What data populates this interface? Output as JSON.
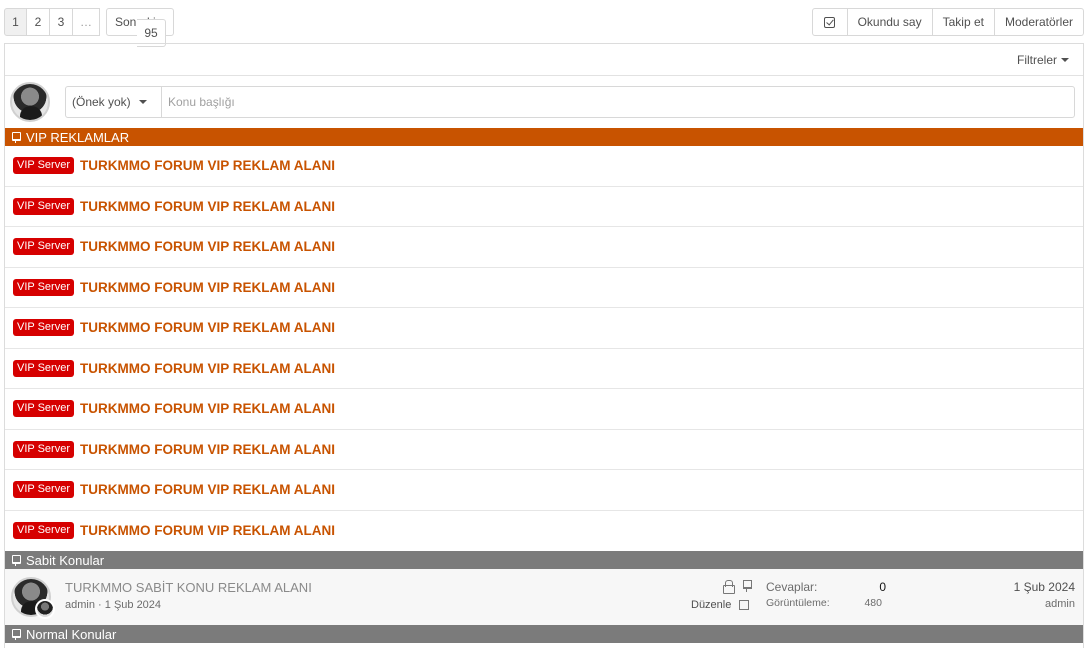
{
  "pagination": {
    "pages": [
      "1",
      "2",
      "3",
      "…",
      "95"
    ],
    "active": "1",
    "next_label": "Sonraki"
  },
  "actions": {
    "mark_read_label": "Okundu say",
    "follow_label": "Takip et",
    "moderators_label": "Moderatörler"
  },
  "filters": {
    "label": "Filtreler"
  },
  "quick_thread": {
    "prefix": "(Önek yok)",
    "placeholder": "Konu başlığı"
  },
  "sections": {
    "vip_title": "VIP REKLAMLAR",
    "sticky_title": "Sabit Konular",
    "normal_title": "Normal Konular"
  },
  "vip_threads": [
    {
      "badge": "VIP Server",
      "title": "TURKMMO FORUM VIP REKLAM ALANI"
    },
    {
      "badge": "VIP Server",
      "title": "TURKMMO FORUM VIP REKLAM ALANI"
    },
    {
      "badge": "VIP Server",
      "title": "TURKMMO FORUM VIP REKLAM ALANI"
    },
    {
      "badge": "VIP Server",
      "title": "TURKMMO FORUM VIP REKLAM ALANI"
    },
    {
      "badge": "VIP Server",
      "title": "TURKMMO FORUM VIP REKLAM ALANI"
    },
    {
      "badge": "VIP Server",
      "title": "TURKMMO FORUM VIP REKLAM ALANI"
    },
    {
      "badge": "VIP Server",
      "title": "TURKMMO FORUM VIP REKLAM ALANI"
    },
    {
      "badge": "VIP Server",
      "title": "TURKMMO FORUM VIP REKLAM ALANI"
    },
    {
      "badge": "VIP Server",
      "title": "TURKMMO FORUM VIP REKLAM ALANI"
    },
    {
      "badge": "VIP Server",
      "title": "TURKMMO FORUM VIP REKLAM ALANI"
    }
  ],
  "sticky_thread": {
    "title": "TURKMMO SABİT KONU REKLAM ALANI",
    "author": "admin",
    "date": "1 Şub 2024",
    "edit_label": "Düzenle",
    "replies_label": "Cevaplar:",
    "replies": "0",
    "views_label": "Görüntüleme:",
    "views": "480",
    "last_date": "1 Şub 2024",
    "last_user": "admin"
  },
  "colors": {
    "vip_accent": "#c85300",
    "badge_red": "#d60000",
    "separator_gray": "#7b7b7b"
  }
}
